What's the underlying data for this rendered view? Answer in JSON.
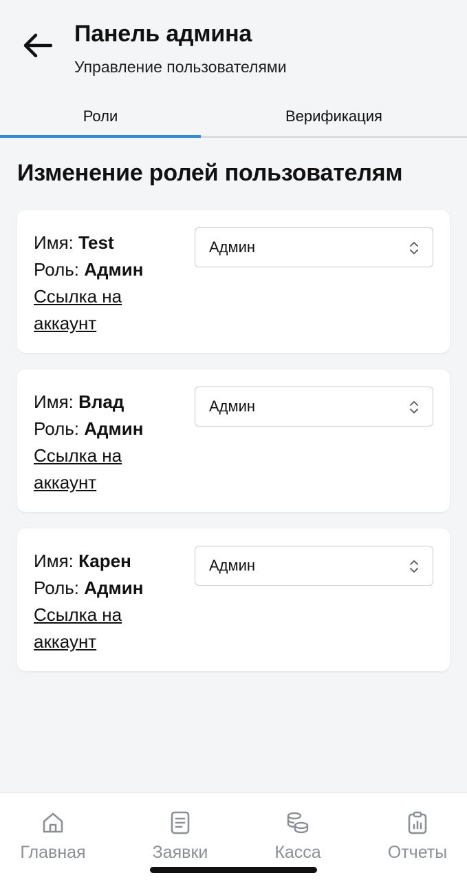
{
  "header": {
    "title": "Панель админа",
    "subtitle": "Управление пользователями"
  },
  "tabs": [
    {
      "label": "Роли",
      "active": true
    },
    {
      "label": "Верификация",
      "active": false
    }
  ],
  "section_title": "Изменение ролей пользователям",
  "labels": {
    "name": "Имя:",
    "role": "Роль:",
    "link": "Ссылка на аккаунт"
  },
  "users": [
    {
      "name": "Test",
      "role": "Админ",
      "selected_role": "Админ"
    },
    {
      "name": "Влад",
      "role": "Админ",
      "selected_role": "Админ"
    },
    {
      "name": "Карен",
      "role": "Админ",
      "selected_role": "Админ"
    }
  ],
  "bottom_nav": [
    {
      "label": "Главная",
      "icon": "home-icon"
    },
    {
      "label": "Заявки",
      "icon": "document-icon"
    },
    {
      "label": "Касса",
      "icon": "coins-icon"
    },
    {
      "label": "Отчеты",
      "icon": "clipboard-icon"
    }
  ],
  "colors": {
    "accent": "#2f8ae0",
    "background": "#f4f5f7",
    "nav_inactive": "#8a8f98"
  }
}
